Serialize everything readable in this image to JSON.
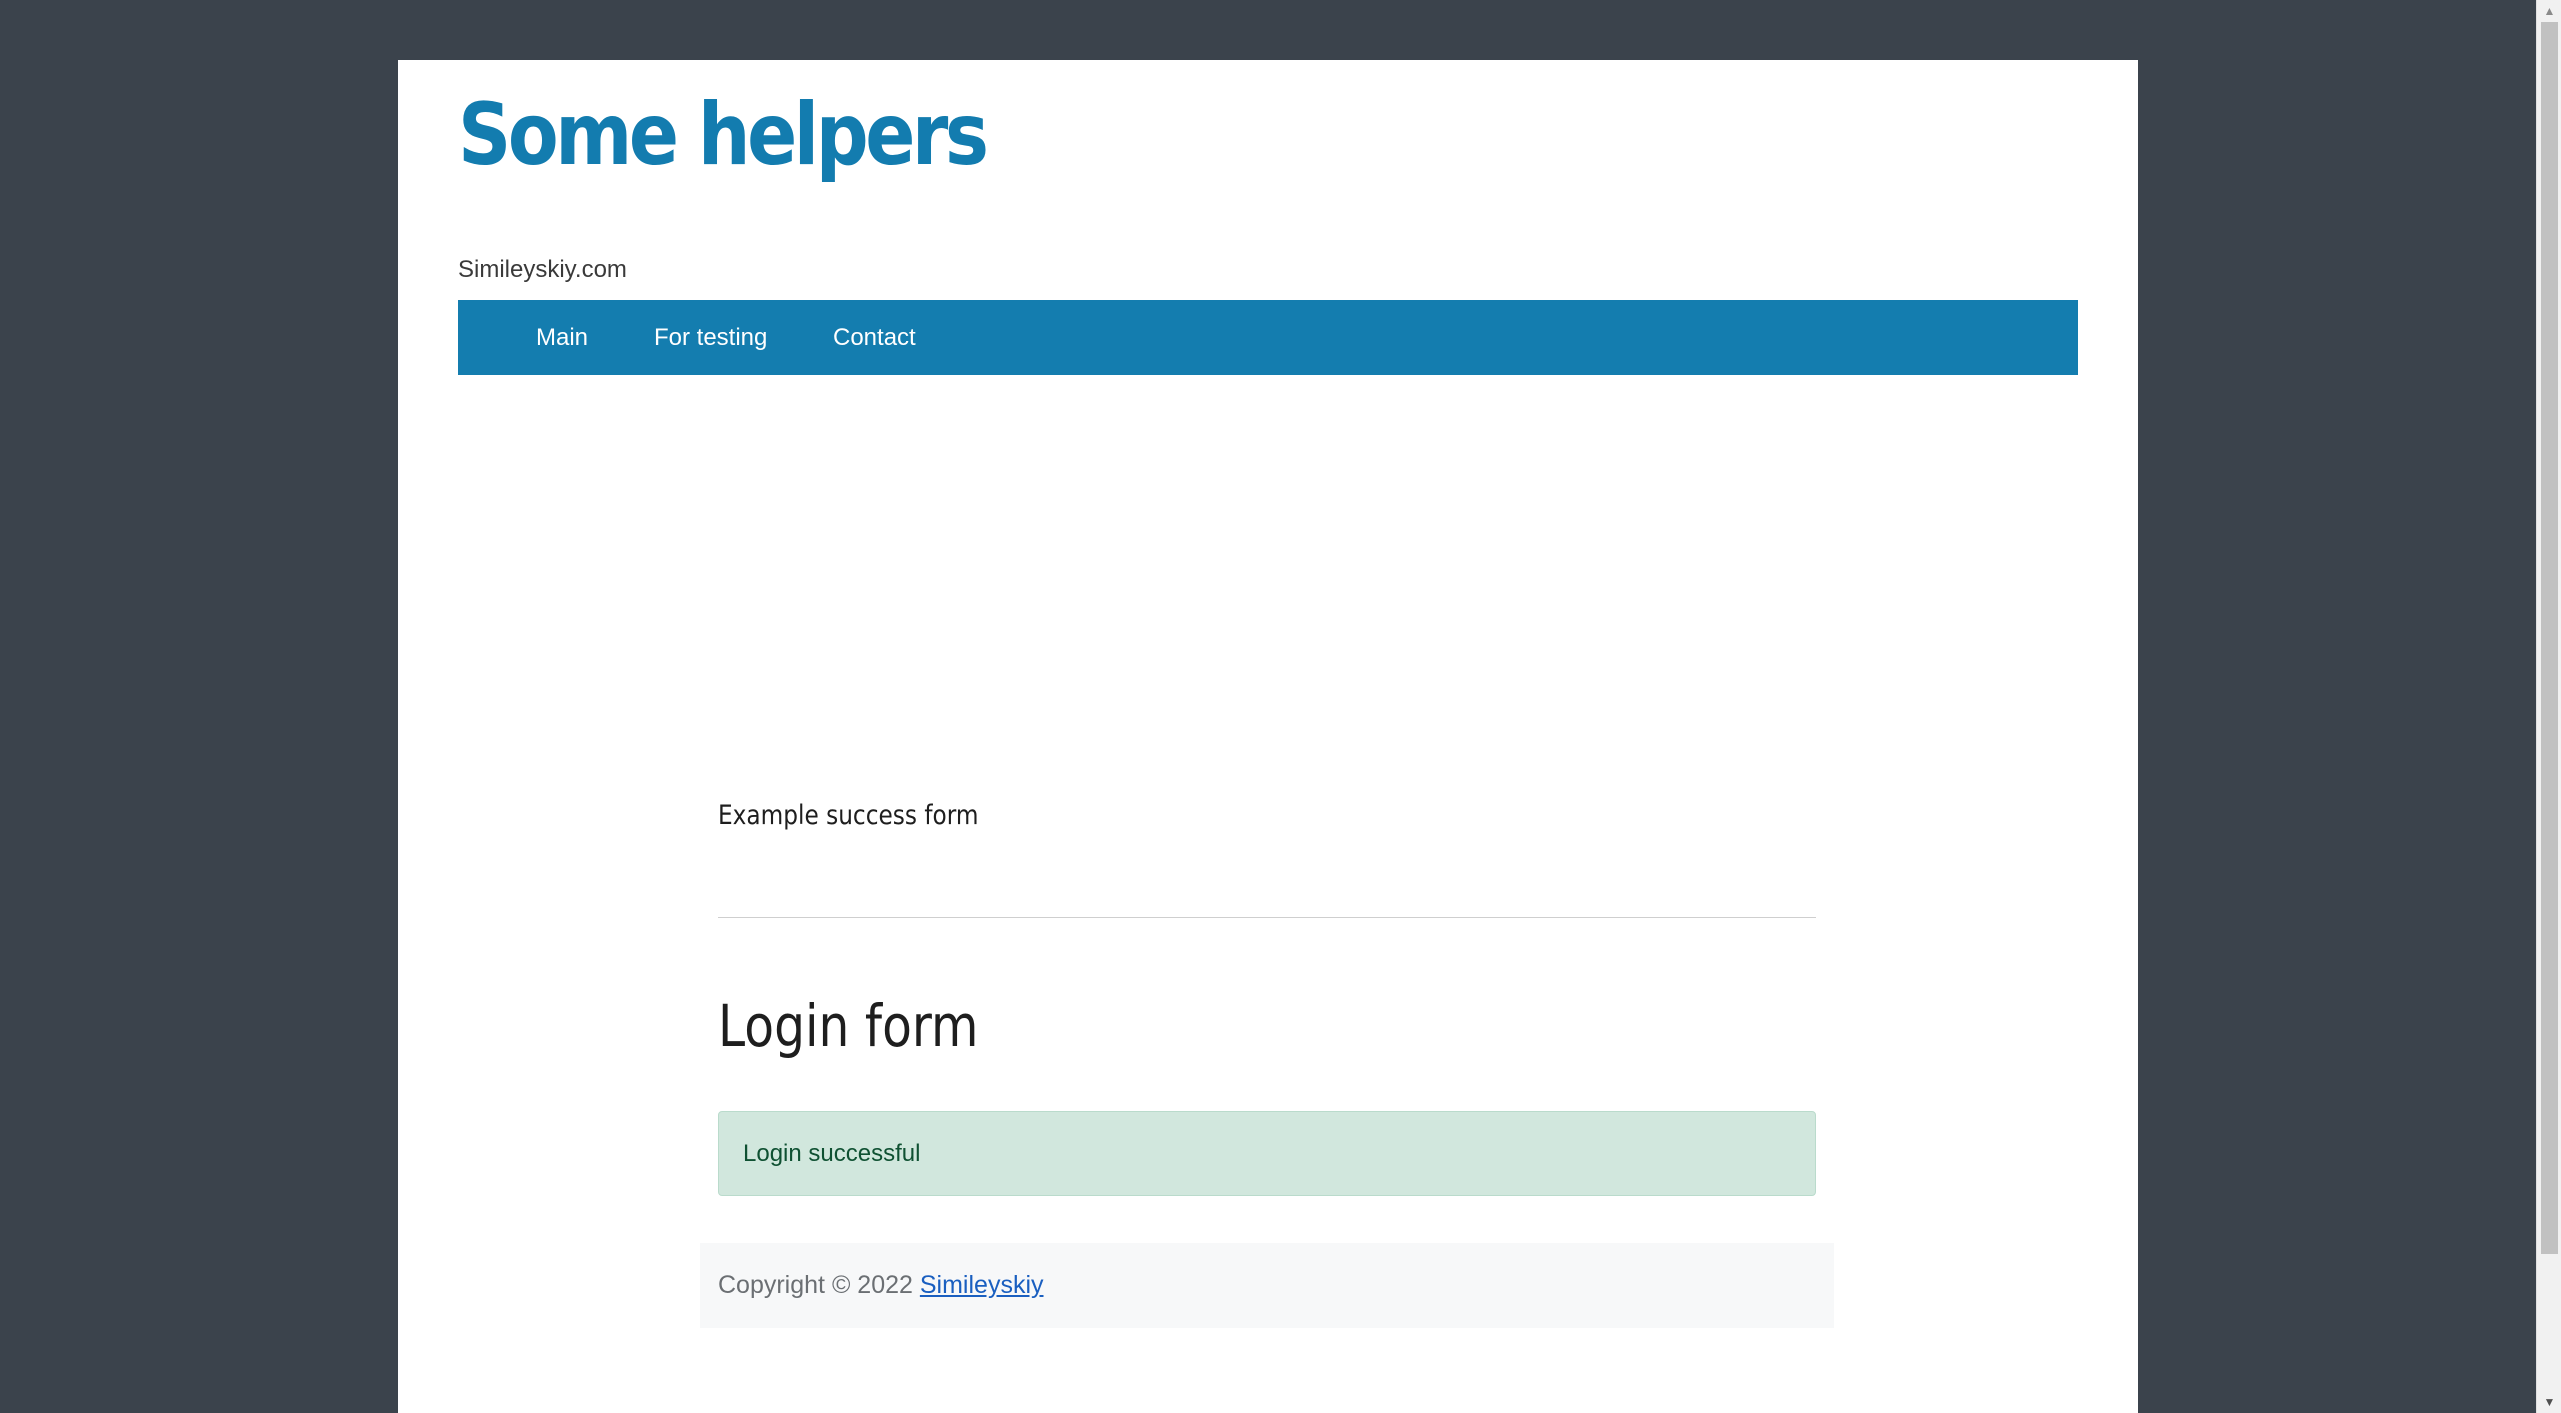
{
  "site": {
    "title": "Some helpers",
    "tagline": "Simileyskiy.com"
  },
  "nav": {
    "items": [
      {
        "label": "Main"
      },
      {
        "label": "For testing"
      },
      {
        "label": "Contact"
      }
    ]
  },
  "main": {
    "subtitle": "Example success form",
    "form_heading": "Login form",
    "alert": {
      "message": "Login successful",
      "type": "success"
    }
  },
  "footer": {
    "copyright": "Copyright © 2022",
    "link_label": "Simileyskiy"
  },
  "colors": {
    "accent": "#147daf",
    "background": "#3b434c",
    "success_bg": "#d1e7dd",
    "success_text": "#0f5132"
  },
  "scrollbar": {
    "up_icon": "arrow-up-icon",
    "down_icon": "arrow-down-icon"
  }
}
